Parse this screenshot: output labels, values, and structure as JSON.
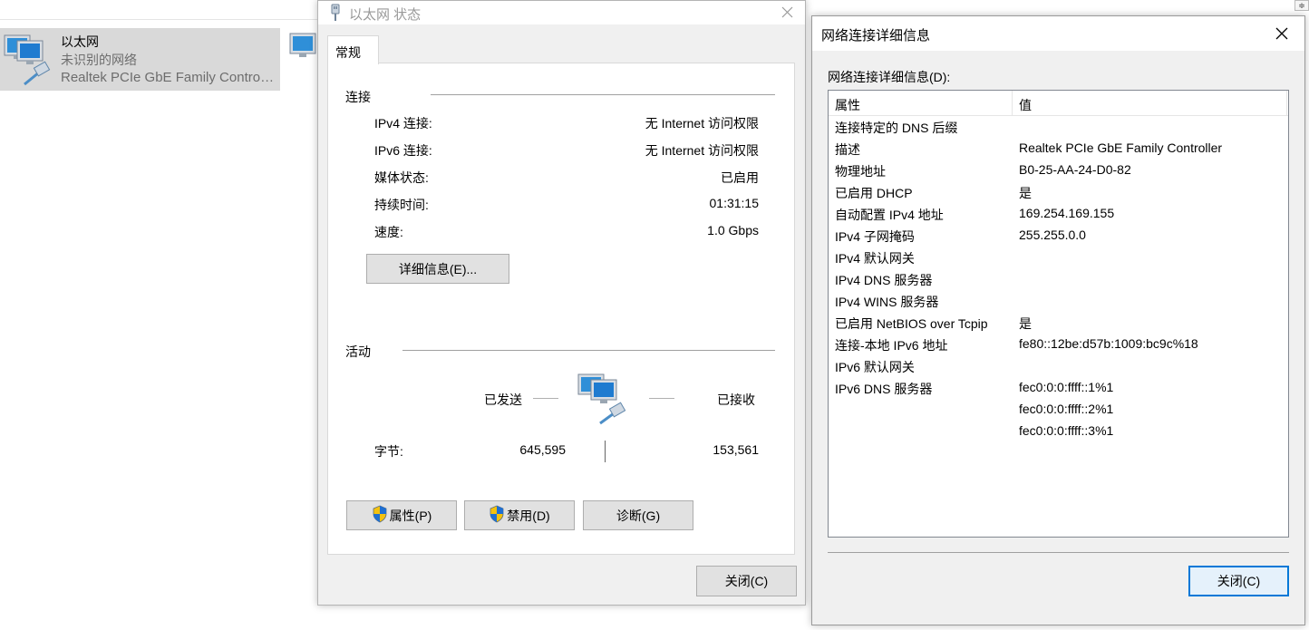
{
  "explorer": {
    "adapter": {
      "name": "以太网",
      "status": "未识别的网络",
      "device": "Realtek PCIe GbE Family Controller"
    },
    "corner_glyph": "≑"
  },
  "status_dialog": {
    "title": "以太网 状态",
    "tab": "常规",
    "connection": {
      "heading": "连接",
      "rows": [
        {
          "label": "IPv4 连接:",
          "value": "无 Internet 访问权限"
        },
        {
          "label": "IPv6 连接:",
          "value": "无 Internet 访问权限"
        },
        {
          "label": "媒体状态:",
          "value": "已启用"
        },
        {
          "label": "持续时间:",
          "value": "01:31:15"
        },
        {
          "label": "速度:",
          "value": "1.0 Gbps"
        }
      ],
      "details_button": "详细信息(E)..."
    },
    "activity": {
      "heading": "活动",
      "sent_label": "已发送",
      "received_label": "已接收",
      "bytes_label": "字节:",
      "bytes_sent": "645,595",
      "bytes_received": "153,561"
    },
    "buttons": {
      "properties": "属性(P)",
      "disable": "禁用(D)",
      "diagnose": "诊断(G)",
      "close": "关闭(C)"
    }
  },
  "details_dialog": {
    "title": "网络连接详细信息",
    "list_label": "网络连接详细信息(D):",
    "columns": {
      "property": "属性",
      "value": "值"
    },
    "rows": [
      {
        "property": "连接特定的 DNS 后缀",
        "value": ""
      },
      {
        "property": "描述",
        "value": "Realtek PCIe GbE Family Controller"
      },
      {
        "property": "物理地址",
        "value": "B0-25-AA-24-D0-82"
      },
      {
        "property": "已启用 DHCP",
        "value": "是"
      },
      {
        "property": "自动配置 IPv4 地址",
        "value": "169.254.169.155"
      },
      {
        "property": "IPv4 子网掩码",
        "value": "255.255.0.0"
      },
      {
        "property": "IPv4 默认网关",
        "value": ""
      },
      {
        "property": "IPv4 DNS 服务器",
        "value": ""
      },
      {
        "property": "IPv4 WINS 服务器",
        "value": ""
      },
      {
        "property": "已启用 NetBIOS over Tcpip",
        "value": "是"
      },
      {
        "property": "连接-本地 IPv6 地址",
        "value": "fe80::12be:d57b:1009:bc9c%18"
      },
      {
        "property": "IPv6 默认网关",
        "value": ""
      },
      {
        "property": "IPv6 DNS 服务器",
        "value": "fec0:0:0:ffff::1%1"
      },
      {
        "property": "",
        "value": "fec0:0:0:ffff::2%1"
      },
      {
        "property": "",
        "value": "fec0:0:0:ffff::3%1"
      }
    ],
    "close_button": "关闭(C)"
  },
  "colors": {
    "dialog_bg": "#f0f0f0",
    "selection_bg": "#d9d9d9",
    "focus_border": "#0078d7",
    "button_bg": "#e1e1e1"
  },
  "icons": [
    "network-adapter-icon",
    "network-plug-icon",
    "close-icon",
    "uac-shield-icon",
    "network-activity-icon"
  ]
}
